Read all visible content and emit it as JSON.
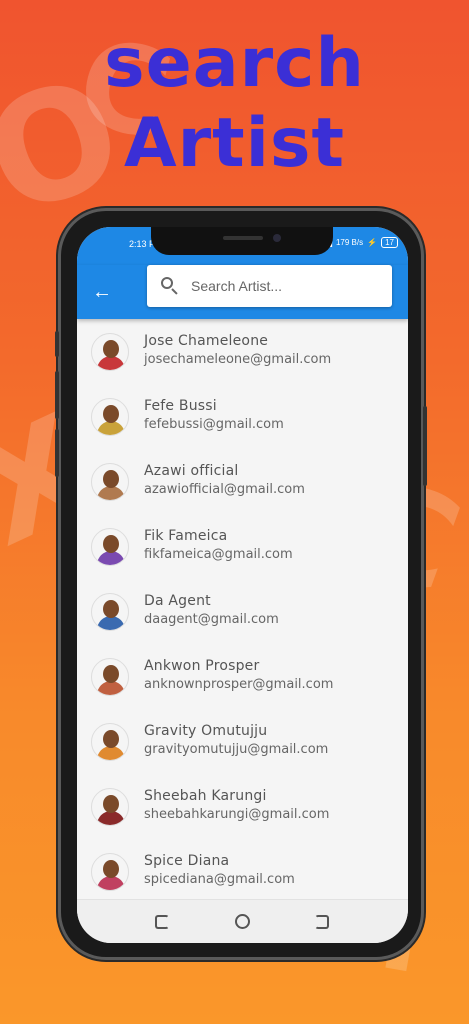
{
  "promo": {
    "headline_line1": "search",
    "headline_line2": "Artist"
  },
  "status_bar": {
    "time": "2:13 PM",
    "network": "179 B/s",
    "battery": "17"
  },
  "app_bar": {
    "back_icon": "arrow-left-icon",
    "search_placeholder": "Search Artist...",
    "search_value": "",
    "color": "#1e88e5"
  },
  "artists": [
    {
      "name": "Jose Chameleone",
      "email": "josechameleone@gmail.com",
      "avatar_color": "#c8373a"
    },
    {
      "name": "Fefe Bussi",
      "email": "fefebussi@gmail.com",
      "avatar_color": "#c9a23a"
    },
    {
      "name": "Azawi official",
      "email": "azawiofficial@gmail.com",
      "avatar_color": "#b07a50"
    },
    {
      "name": "Fik Fameica",
      "email": "fikfameica@gmail.com",
      "avatar_color": "#7a4ab0"
    },
    {
      "name": "Da Agent",
      "email": "daagent@gmail.com",
      "avatar_color": "#3a6ab0"
    },
    {
      "name": "Ankwon Prosper",
      "email": "anknownprosper@gmail.com",
      "avatar_color": "#c06040"
    },
    {
      "name": "Gravity Omutujju",
      "email": "gravityomutujju@gmail.com",
      "avatar_color": "#e08a30"
    },
    {
      "name": "Sheebah Karungi",
      "email": "sheebahkarungi@gmail.com",
      "avatar_color": "#8a2a2a"
    },
    {
      "name": "Spice Diana",
      "email": "spicediana@gmail.com",
      "avatar_color": "#c04060"
    }
  ],
  "nav_bar": {
    "recent_icon": "recent-apps-icon",
    "home_icon": "home-circle-icon",
    "back_icon": "nav-back-icon"
  }
}
